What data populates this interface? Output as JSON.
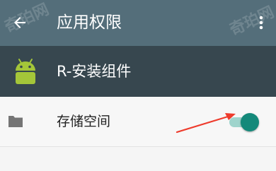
{
  "appbar": {
    "title": "应用权限",
    "back_icon": "arrow-back-icon",
    "overflow_icon": "more-vert-icon"
  },
  "app": {
    "name": "R-安装组件",
    "icon": "android-icon"
  },
  "permissions": [
    {
      "label": "存储空间",
      "icon": "folder-icon",
      "enabled": true
    }
  ],
  "watermark": {
    "text_a": "奇珀网",
    "text_b": "奇珀网"
  },
  "colors": {
    "appbar": "#546e7a",
    "app_header": "#37474f",
    "toggle_on": "#14897a",
    "android_green": "#a4c639",
    "arrow": "#ee3b2c"
  }
}
